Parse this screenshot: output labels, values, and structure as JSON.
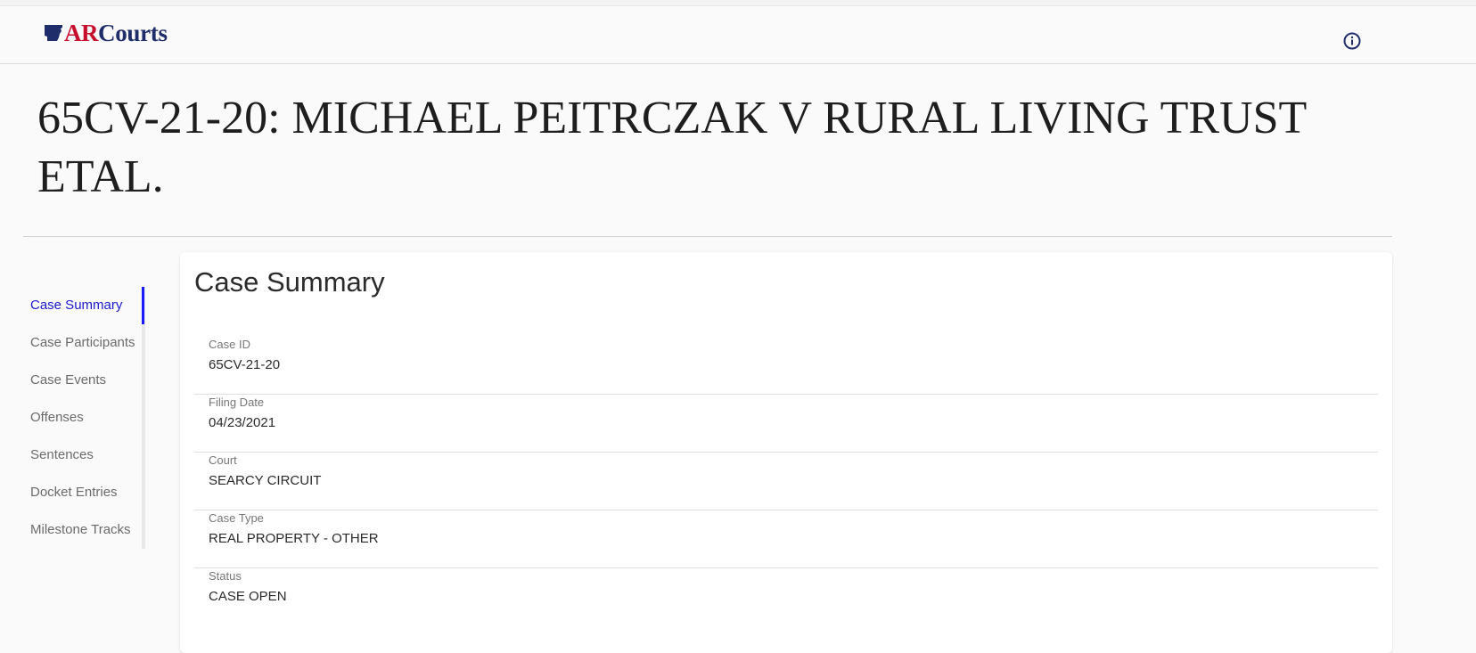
{
  "navbar": {
    "logo": {
      "part1": "AR",
      "part2": "Courts"
    },
    "info_icon": "info-circle-icon",
    "colors": {
      "logo_red": "#c8102e",
      "logo_navy": "#1f2d6b"
    }
  },
  "page": {
    "title": "65CV-21-20: MICHAEL PEITRCZAK V RURAL LIVING TRUST ETAL."
  },
  "sidebar": {
    "active_color": "#1a1aff",
    "items": [
      {
        "label": "Case Summary",
        "active": true
      },
      {
        "label": "Case Participants",
        "active": false
      },
      {
        "label": "Case Events",
        "active": false
      },
      {
        "label": "Offenses",
        "active": false
      },
      {
        "label": "Sentences",
        "active": false
      },
      {
        "label": "Docket Entries",
        "active": false
      },
      {
        "label": "Milestone Tracks",
        "active": false
      }
    ]
  },
  "summary": {
    "heading": "Case Summary",
    "fields": [
      {
        "label": "Case ID",
        "value": "65CV-21-20"
      },
      {
        "label": "Filing Date",
        "value": "04/23/2021"
      },
      {
        "label": "Court",
        "value": "SEARCY CIRCUIT"
      },
      {
        "label": "Case Type",
        "value": "REAL PROPERTY - OTHER"
      },
      {
        "label": "Status",
        "value": "CASE OPEN"
      }
    ]
  }
}
